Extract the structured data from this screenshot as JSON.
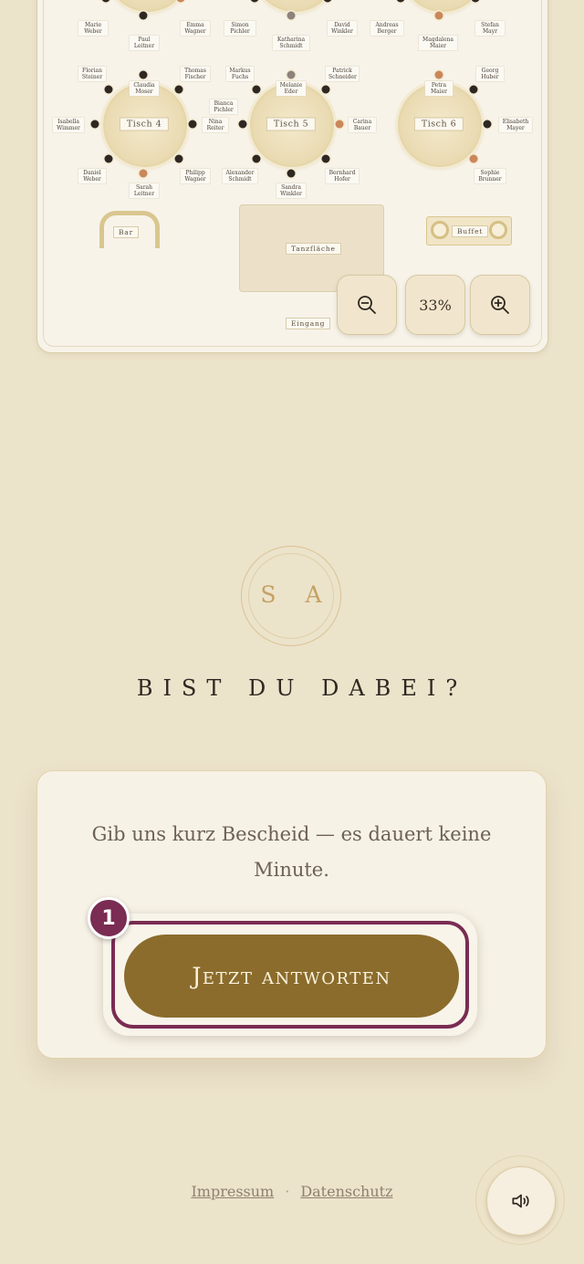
{
  "seating_plan": {
    "tables": [
      {
        "label": "Tisch 4"
      },
      {
        "label": "Tisch 5"
      },
      {
        "label": "Tisch 6"
      }
    ],
    "guests_top_row": [
      "Marie Weber",
      "Paul Leitner",
      "Emma Wagner",
      "Simon Pichler",
      "Katharina Schmidt",
      "David Winkler",
      "Andreas Berger",
      "Magdalena Maier",
      "Stefan Mayr"
    ],
    "table4_guests": [
      "Florian Steiner",
      "Claudia Moser",
      "Thomas Fischer",
      "Isabella Wimmer",
      "Nina Reiter",
      "Daniel Weber",
      "Sarah Leitner",
      "Philipp Wagner"
    ],
    "table5_guests": [
      "Markus Fuchs",
      "Melanie Eder",
      "Patrick Schneider",
      "Bianca Pichler",
      "Carina Bauer",
      "Alexander Schmidt",
      "Sandra Winkler",
      "Bernhard Hofer"
    ],
    "table6_guests": [
      "Petra Maier",
      "Georg Huber",
      "Elisabeth Mayer",
      "Sophie Brunner"
    ],
    "areas": {
      "bar": "Bar",
      "dancefloor": "Tanzfläche",
      "buffet": "Buffet",
      "entrance": "Eingang"
    },
    "zoom": {
      "level": "33%",
      "zoom_out_icon": "zoom-out-icon",
      "zoom_in_icon": "zoom-in-icon"
    }
  },
  "monogram": "S A",
  "headline": "BIST DU DABEI?",
  "rsvp": {
    "text": "Gib uns kurz Bescheid — es dauert keine Minute.",
    "button_label": "Jetzt antworten",
    "step_badge": "1"
  },
  "footer": {
    "impressum": "Impressum",
    "separator": "·",
    "datenschutz": "Datenschutz",
    "sound_icon": "speaker-icon"
  },
  "colors": {
    "background": "#ece3cb",
    "accent_gold": "#8b6c2c",
    "highlight": "#7a2c52"
  }
}
